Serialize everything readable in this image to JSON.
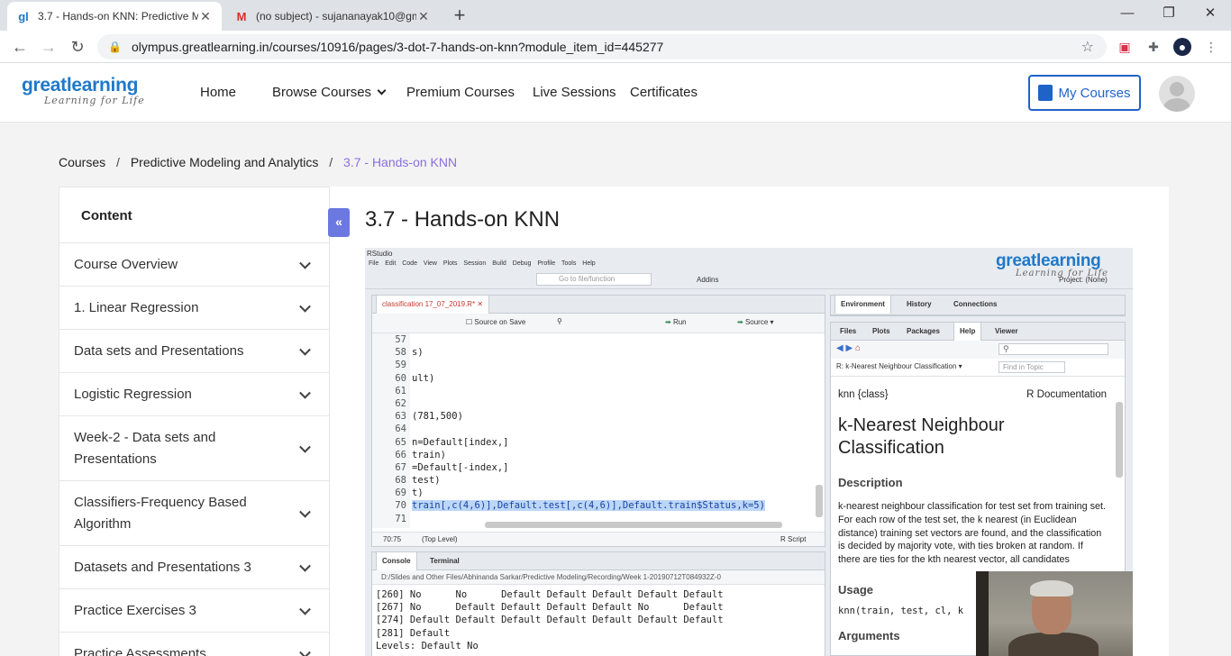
{
  "browser": {
    "tabs": [
      {
        "title": "3.7 - Hands-on KNN: Predictive M",
        "favicon": "gl-favicon-icon"
      },
      {
        "title": "(no subject) - sujananayak10@gm",
        "favicon": "gmail-favicon-icon"
      }
    ],
    "url": "olympus.greatlearning.in/courses/10916/pages/3-dot-7-hands-on-knn?module_item_id=445277"
  },
  "site": {
    "logo_name": "greatlearning",
    "logo_tag": "Learning for Life",
    "nav": [
      "Home",
      "Browse Courses",
      "Premium Courses",
      "Live Sessions",
      "Certificates"
    ],
    "my_courses": "My Courses"
  },
  "breadcrumb": {
    "items": [
      "Courses",
      "Predictive Modeling and Analytics",
      "3.7 - Hands-on KNN"
    ],
    "separator": "/"
  },
  "sidebar": {
    "heading": "Content",
    "items": [
      {
        "label": "Course Overview"
      },
      {
        "label": "1. Linear Regression"
      },
      {
        "label": "Data sets and Presentations"
      },
      {
        "label": "Logistic Regression"
      },
      {
        "label": "Week-2 - Data sets and Presentations"
      },
      {
        "label": "Classifiers-Frequency Based Algorithm"
      },
      {
        "label": "Datasets and Presentations 3"
      },
      {
        "label": "Practice Exercises 3"
      },
      {
        "label": "Practice Assessments"
      }
    ]
  },
  "main": {
    "title": "3.7 - Hands-on KNN",
    "collapse_glyph": "«"
  },
  "rstudio": {
    "app_title": "RStudio",
    "menu": "File Edit Code View Plots Session Build Debug Profile Tools Help",
    "goto_placeholder": "Go to file/function",
    "addins": "Addins",
    "project": "Project: (None)",
    "editor": {
      "tab": "classification 17_07_2019.R*",
      "source_on_save": "Source on Save",
      "run": "Run",
      "source": "Source",
      "line_numbers": [
        "57",
        "58",
        "59",
        "60",
        "61",
        "62",
        "63",
        "64",
        "65",
        "66",
        "67",
        "68",
        "69",
        "70",
        "71"
      ],
      "lines": [
        "",
        "s)",
        "",
        "ult)",
        "",
        "",
        "(781,500)",
        "",
        "n=Default[index,]",
        "train)",
        "=Default[-index,]",
        "test)",
        "t)",
        "train[,c(4,6)],Default.test[,c(4,6)],Default.train$Status,k=5)",
        ""
      ],
      "cursor_pos": "70:75",
      "scope": "(Top Level)",
      "file_type": "R Script"
    },
    "console": {
      "tabs": [
        "Console",
        "Terminal"
      ],
      "path": "D:/Slides and Other Files/Abhinanda Sarkar/Predictive Modeling/Recording/Week 1-20190712T084932Z-0",
      "lines": [
        "[260] No      No      Default Default Default Default Default",
        "[267] No      Default Default Default Default No      Default",
        "[274] Default Default Default Default Default Default Default",
        "[281] Default",
        "Levels: Default No"
      ]
    },
    "env_tabs": [
      "Environment",
      "History",
      "Connections"
    ],
    "help_tabs": [
      "Files",
      "Plots",
      "Packages",
      "Help",
      "Viewer"
    ],
    "help_topic": "R: k-Nearest Neighbour Classification",
    "find_topic_placeholder": "Find in Topic",
    "help": {
      "package": "knn {class}",
      "doc": "R Documentation",
      "title": "k-Nearest Neighbour Classification",
      "description_heading": "Description",
      "description": "k-nearest neighbour classification for test set from training set. For each row of the test set, the k nearest (in Euclidean distance) training set vectors are found, and the classification is decided by majority vote, with ties broken at random. If there are ties for the kth nearest vector, all candidates",
      "usage_heading": "Usage",
      "usage": "knn(train, test, cl, k",
      "arguments_heading": "Arguments"
    }
  },
  "colors": {
    "brand_blue": "#1f79c9",
    "breadcrumb_current": "#8a6ee0",
    "collapse_button": "#6b78e0",
    "code_highlight": "#bcd6f7"
  }
}
